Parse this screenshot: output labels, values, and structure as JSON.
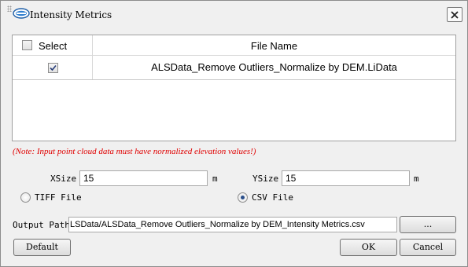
{
  "window": {
    "title": "Intensity Metrics",
    "icon": "lidar360-logo",
    "close_icon": "close-icon"
  },
  "table": {
    "columns": [
      "Select",
      "File Name"
    ],
    "select_all_checked": false,
    "rows": [
      {
        "checked": true,
        "file_name": "ALSData_Remove Outliers_Normalize by DEM.LiData"
      }
    ]
  },
  "note": "(Note: Input point cloud data must have normalized elevation values!)",
  "note_color": "#e00000",
  "params": {
    "xsize_label": "XSize",
    "xsize_value": "15",
    "xsize_unit": "m",
    "ysize_label": "YSize",
    "ysize_value": "15",
    "ysize_unit": "m"
  },
  "output_format": {
    "options": [
      "TIFF File",
      "CSV File"
    ],
    "selected": "CSV File"
  },
  "output_path": {
    "label": "Output Path:",
    "value": "LSData/ALSData_Remove Outliers_Normalize by DEM_Intensity Metrics.csv",
    "browse_label": "..."
  },
  "buttons": {
    "default": "Default",
    "ok": "OK",
    "cancel": "Cancel"
  }
}
